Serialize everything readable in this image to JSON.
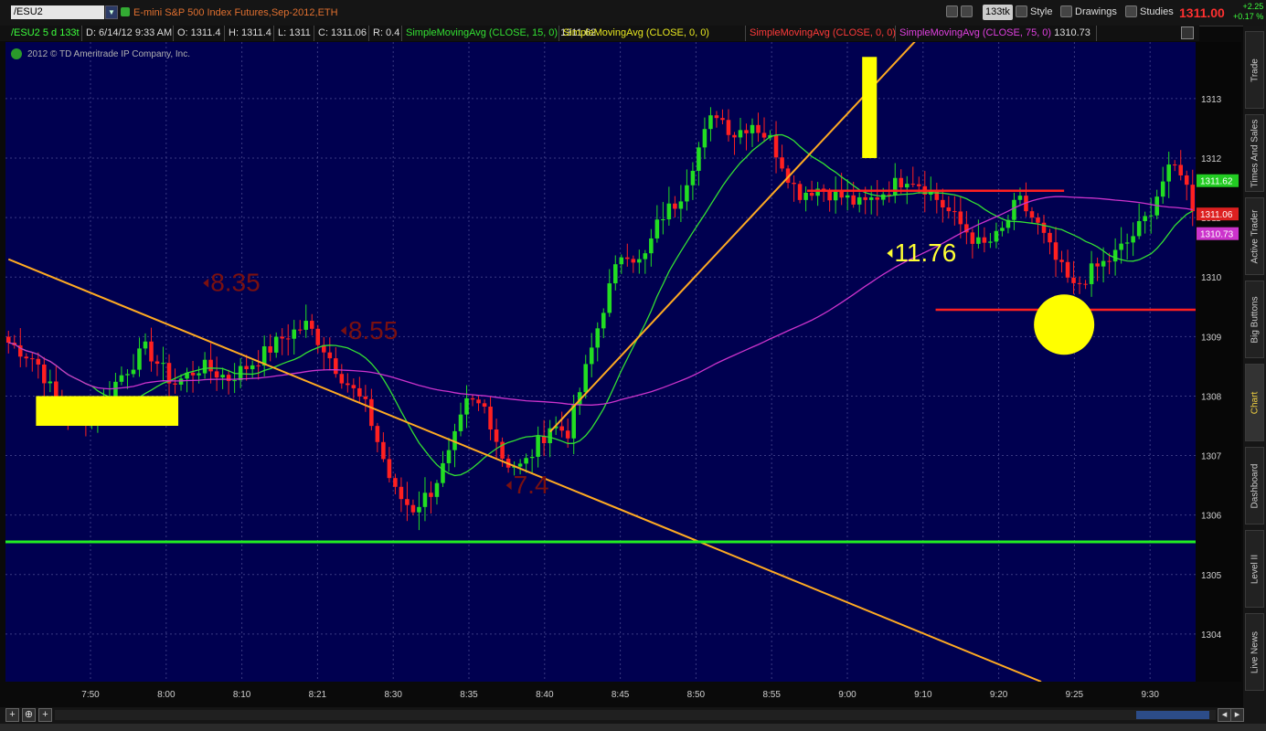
{
  "header": {
    "symbol": "/ESU2",
    "description": "E-mini S&P 500 Index Futures,Sep-2012,ETH",
    "aggregation": "133tk",
    "style_label": "Style",
    "drawings_label": "Drawings",
    "studies_label": "Studies",
    "last_price": "1311.00",
    "change": "+2.25",
    "change_pct": "+0.17 %"
  },
  "info": {
    "symbol_period": "/ESU2 5 d 133t",
    "datetime": "D: 6/14/12 9:33 AM",
    "open": "O: 1311.4",
    "high": "H: 1311.4",
    "low": "L: 1311",
    "close": "C: 1311.06",
    "range": "R: 0.4",
    "studies": [
      {
        "label": "SimpleMovingAvg (CLOSE, 15, 0)",
        "value": "1311.62",
        "color": "#33e033"
      },
      {
        "label": "SimpleMovingAvg (CLOSE, 0, 0)",
        "value": "",
        "color": "#e8e820"
      },
      {
        "label": "SimpleMovingAvg (CLOSE, 0, 0)",
        "value": "",
        "color": "#ff3a3a"
      },
      {
        "label": "SimpleMovingAvg (CLOSE, 75, 0)",
        "value": "1310.73",
        "color": "#e040e0"
      }
    ],
    "copyright": "2012 © TD Ameritrade IP Company, Inc."
  },
  "price_labels": [
    {
      "text": "1311.62",
      "price": 1311.62,
      "color": "#22cc22"
    },
    {
      "text": "1311.06",
      "price": 1311.06,
      "color": "#dd2020"
    },
    {
      "text": "1310.73",
      "price": 1310.73,
      "color": "#cc33cc"
    }
  ],
  "side_tabs": [
    {
      "label": "Trade",
      "active": false
    },
    {
      "label": "Times And Sales",
      "active": false
    },
    {
      "label": "Active Trader",
      "active": false
    },
    {
      "label": "Big Buttons",
      "active": false
    },
    {
      "label": "Chart",
      "active": true
    },
    {
      "label": "Dashboard",
      "active": false
    },
    {
      "label": "Level II",
      "active": false
    },
    {
      "label": "Live News",
      "active": false
    }
  ],
  "colors": {
    "background": "#000050",
    "grid": "#3a3a82",
    "up": "#22dd22",
    "down": "#ff2020",
    "sma15": "#33e033",
    "sma75": "#cc33cc",
    "trendline": "#ffaa22",
    "support": "#22ee22",
    "resistance": "#ff2020",
    "highlight": "#ffff00",
    "annotation_dark": "#7a1010",
    "annotation_light": "#ffff33"
  },
  "chart_data": {
    "type": "candlestick",
    "y_range": [
      1303.2,
      1313.95
    ],
    "y_ticks": [
      1304,
      1305,
      1306,
      1307,
      1308,
      1309,
      1310,
      1311,
      1312,
      1313
    ],
    "x_ticks": [
      "7:50",
      "8:00",
      "8:10",
      "8:21",
      "8:30",
      "8:35",
      "8:40",
      "8:45",
      "8:50",
      "8:55",
      "9:00",
      "9:10",
      "9:20",
      "9:25",
      "9:30"
    ],
    "bars": 200,
    "close_path": [
      [
        0,
        1308.9
      ],
      [
        6,
        1308.6
      ],
      [
        12,
        1307.7
      ],
      [
        18,
        1307.6
      ],
      [
        24,
        1308.3
      ],
      [
        30,
        1308.8
      ],
      [
        36,
        1308.2
      ],
      [
        42,
        1308.5
      ],
      [
        48,
        1308.3
      ],
      [
        54,
        1308.6
      ],
      [
        60,
        1309.0
      ],
      [
        65,
        1309.2
      ],
      [
        68,
        1308.9
      ],
      [
        72,
        1308.4
      ],
      [
        78,
        1307.8
      ],
      [
        84,
        1306.4
      ],
      [
        88,
        1306.1
      ],
      [
        92,
        1306.4
      ],
      [
        96,
        1307.0
      ],
      [
        100,
        1307.9
      ],
      [
        104,
        1307.8
      ],
      [
        108,
        1306.9
      ],
      [
        112,
        1306.8
      ],
      [
        118,
        1307.5
      ],
      [
        122,
        1307.4
      ],
      [
        126,
        1308.5
      ],
      [
        130,
        1309.6
      ],
      [
        134,
        1310.5
      ],
      [
        138,
        1310.2
      ],
      [
        142,
        1311.0
      ],
      [
        146,
        1311.3
      ],
      [
        150,
        1312.1
      ],
      [
        154,
        1312.8
      ],
      [
        158,
        1312.4
      ],
      [
        162,
        1312.6
      ],
      [
        166,
        1312.3
      ],
      [
        172,
        1311.4
      ],
      [
        176,
        1311.5
      ],
      [
        180,
        1311.4
      ],
      [
        186,
        1311.2
      ],
      [
        192,
        1311.5
      ],
      [
        196,
        1311.7
      ],
      [
        200,
        1311.5
      ],
      [
        206,
        1311.0
      ],
      [
        212,
        1310.5
      ],
      [
        216,
        1310.7
      ],
      [
        220,
        1311.3
      ],
      [
        224,
        1310.9
      ],
      [
        228,
        1310.3
      ],
      [
        232,
        1309.8
      ],
      [
        236,
        1310.1
      ],
      [
        240,
        1310.3
      ],
      [
        244,
        1310.6
      ],
      [
        248,
        1311.0
      ],
      [
        252,
        1311.7
      ],
      [
        255,
        1311.9
      ],
      [
        258,
        1311.2
      ]
    ],
    "sma15": "15-period simple moving average of close",
    "sma75": "75-period simple moving average of close",
    "trendlines": [
      {
        "from": [
          0,
          1310.3
        ],
        "to": [
          225,
          1303.2
        ]
      },
      {
        "from": [
          118,
          1307.4
        ],
        "to": [
          198,
          1314.0
        ]
      }
    ],
    "support_price": 1305.55,
    "resistance_lines": [
      {
        "price": 1311.45
      },
      {
        "price": 1309.45
      }
    ],
    "highlight_boxes": [
      {
        "price_from": 1307.5,
        "price_to": 1308.0
      },
      {
        "price_from": 1312.0,
        "price_to": 1313.7
      }
    ],
    "highlight_circle": {
      "price": 1309.2
    },
    "annotations": [
      {
        "text": "8.35",
        "price": 1309.9,
        "color": "dark"
      },
      {
        "text": "8.55",
        "price": 1309.1,
        "color": "dark"
      },
      {
        "text": "7.4",
        "price": 1306.5,
        "color": "dark"
      },
      {
        "text": "11.76",
        "price": 1310.4,
        "color": "light"
      }
    ]
  }
}
